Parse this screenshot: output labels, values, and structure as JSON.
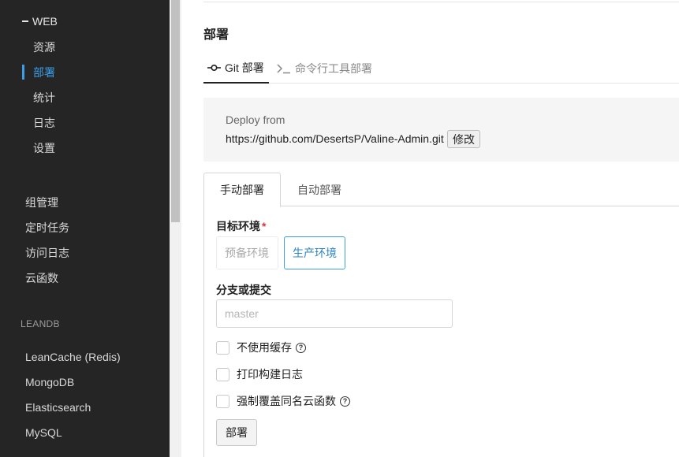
{
  "sidebar": {
    "group": {
      "label": "WEB"
    },
    "sub_items": [
      {
        "label": "资源"
      },
      {
        "label": "部署"
      },
      {
        "label": "统计"
      },
      {
        "label": "日志"
      },
      {
        "label": "设置"
      }
    ],
    "active_item": "部署",
    "items": [
      {
        "label": "组管理"
      },
      {
        "label": "定时任务"
      },
      {
        "label": "访问日志"
      },
      {
        "label": "云函数"
      }
    ],
    "section_label": "LEANDB",
    "db_items": [
      {
        "label": "LeanCache (Redis)"
      },
      {
        "label": "MongoDB"
      },
      {
        "label": "Elasticsearch"
      },
      {
        "label": "MySQL"
      }
    ]
  },
  "main": {
    "title": "部署",
    "tabs": [
      {
        "label": "Git 部署",
        "icon": "git-commit-icon",
        "active": true
      },
      {
        "label": "命令行工具部署",
        "icon": "terminal-icon",
        "active": false
      }
    ],
    "deploy_source": {
      "label": "Deploy from",
      "url": "https://github.com/DesertsP/Valine-Admin.git",
      "edit_label": "修改"
    },
    "sub_tabs": [
      {
        "label": "手动部署",
        "active": true
      },
      {
        "label": "自动部署",
        "active": false
      }
    ],
    "form": {
      "env_label": "目标环境",
      "required_mark": "*",
      "env_options": [
        {
          "label": "预备环境",
          "selected": false
        },
        {
          "label": "生产环境",
          "selected": true
        }
      ],
      "branch_label": "分支或提交",
      "branch_placeholder": "master",
      "branch_value": "",
      "checkboxes": [
        {
          "label": "不使用缓存",
          "checked": false,
          "help": true
        },
        {
          "label": "打印构建日志",
          "checked": false,
          "help": false
        },
        {
          "label": "强制覆盖同名云函数",
          "checked": false,
          "help": true
        }
      ],
      "help_glyph": "?",
      "submit_label": "部署"
    }
  },
  "colors": {
    "sidebar_bg": "#252526",
    "accent": "#3c9ee5",
    "required": "#d9363e"
  }
}
